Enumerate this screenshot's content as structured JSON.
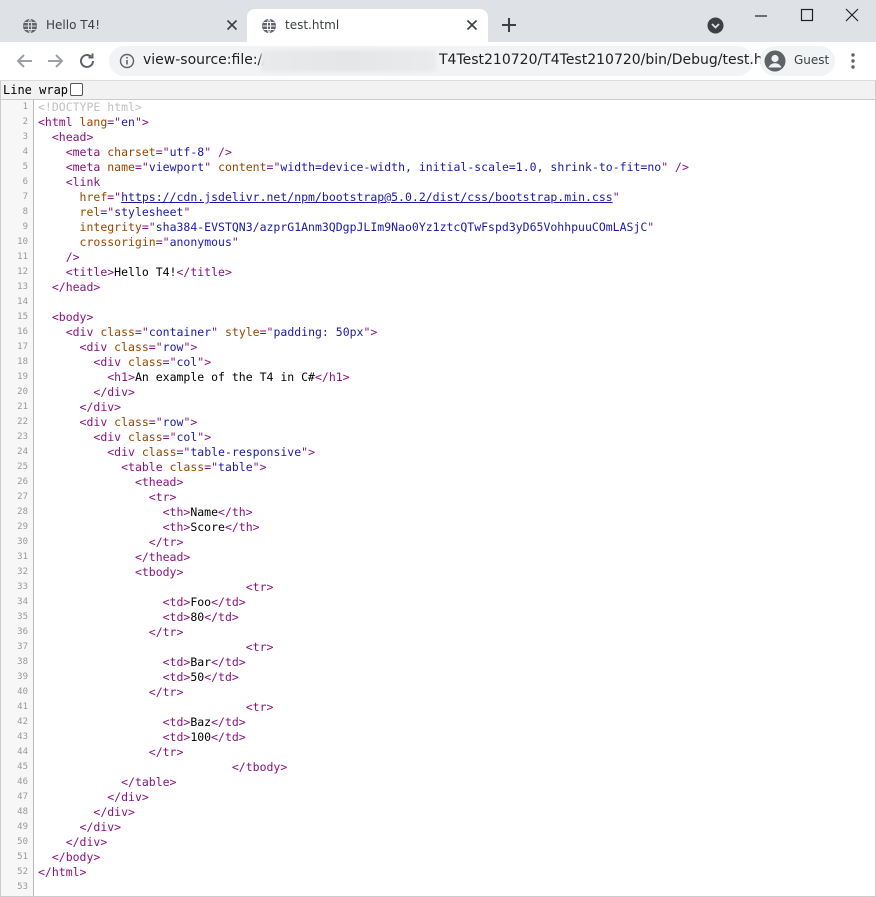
{
  "browser": {
    "tabs": [
      {
        "title": "Hello T4!",
        "active": false,
        "icon": "globe-icon"
      },
      {
        "title": "test.html",
        "active": true,
        "icon": "globe-icon"
      }
    ],
    "address": {
      "prefix": "view-source:file:///",
      "suffix": "T4Test210720/T4Test210720/bin/Debug/test.h..."
    },
    "profile_name": "Guest"
  },
  "colors": {
    "tag": "#881280",
    "attribute": "#994500",
    "value": "#1a1aa6",
    "doctype": "#c0c0c0",
    "tabstrip": "#dee1e6"
  },
  "viewer": {
    "line_wrap_label": "Line wrap",
    "line_wrap_checked": false
  },
  "lines": [
    [
      [
        "doctype",
        "<!DOCTYPE html>"
      ]
    ],
    [
      [
        "tag",
        "<html "
      ],
      [
        "attr",
        "lang"
      ],
      [
        "tag",
        "=\""
      ],
      [
        "val",
        "en"
      ],
      [
        "tag",
        "\">"
      ]
    ],
    [
      [
        "text",
        "  "
      ],
      [
        "tag",
        "<head>"
      ]
    ],
    [
      [
        "text",
        "    "
      ],
      [
        "tag",
        "<meta "
      ],
      [
        "attr",
        "charset"
      ],
      [
        "tag",
        "=\""
      ],
      [
        "val",
        "utf-8"
      ],
      [
        "tag",
        "\" />"
      ]
    ],
    [
      [
        "text",
        "    "
      ],
      [
        "tag",
        "<meta "
      ],
      [
        "attr",
        "name"
      ],
      [
        "tag",
        "=\""
      ],
      [
        "val",
        "viewport"
      ],
      [
        "tag",
        "\" "
      ],
      [
        "attr",
        "content"
      ],
      [
        "tag",
        "=\""
      ],
      [
        "val",
        "width=device-width, initial-scale=1.0, shrink-to-fit=no"
      ],
      [
        "tag",
        "\" />"
      ]
    ],
    [
      [
        "text",
        "    "
      ],
      [
        "tag",
        "<link"
      ]
    ],
    [
      [
        "text",
        "      "
      ],
      [
        "attr",
        "href"
      ],
      [
        "tag",
        "=\""
      ],
      [
        "link",
        "https://cdn.jsdelivr.net/npm/bootstrap@5.0.2/dist/css/bootstrap.min.css"
      ],
      [
        "tag",
        "\""
      ]
    ],
    [
      [
        "text",
        "      "
      ],
      [
        "attr",
        "rel"
      ],
      [
        "tag",
        "=\""
      ],
      [
        "val",
        "stylesheet"
      ],
      [
        "tag",
        "\""
      ]
    ],
    [
      [
        "text",
        "      "
      ],
      [
        "attr",
        "integrity"
      ],
      [
        "tag",
        "=\""
      ],
      [
        "val",
        "sha384-EVSTQN3/azprG1Anm3QDgpJLIm9Nao0Yz1ztcQTwFspd3yD65VohhpuuCOmLASjC"
      ],
      [
        "tag",
        "\""
      ]
    ],
    [
      [
        "text",
        "      "
      ],
      [
        "attr",
        "crossorigin"
      ],
      [
        "tag",
        "=\""
      ],
      [
        "val",
        "anonymous"
      ],
      [
        "tag",
        "\""
      ]
    ],
    [
      [
        "text",
        "    "
      ],
      [
        "tag",
        "/>"
      ]
    ],
    [
      [
        "text",
        "    "
      ],
      [
        "tag",
        "<title>"
      ],
      [
        "text",
        "Hello T4!"
      ],
      [
        "tag",
        "</title>"
      ]
    ],
    [
      [
        "text",
        "  "
      ],
      [
        "tag",
        "</head>"
      ]
    ],
    [],
    [
      [
        "text",
        "  "
      ],
      [
        "tag",
        "<body>"
      ]
    ],
    [
      [
        "text",
        "    "
      ],
      [
        "tag",
        "<div "
      ],
      [
        "attr",
        "class"
      ],
      [
        "tag",
        "=\""
      ],
      [
        "val",
        "container"
      ],
      [
        "tag",
        "\" "
      ],
      [
        "attr",
        "style"
      ],
      [
        "tag",
        "=\""
      ],
      [
        "val",
        "padding: 50px"
      ],
      [
        "tag",
        "\">"
      ]
    ],
    [
      [
        "text",
        "      "
      ],
      [
        "tag",
        "<div "
      ],
      [
        "attr",
        "class"
      ],
      [
        "tag",
        "=\""
      ],
      [
        "val",
        "row"
      ],
      [
        "tag",
        "\">"
      ]
    ],
    [
      [
        "text",
        "        "
      ],
      [
        "tag",
        "<div "
      ],
      [
        "attr",
        "class"
      ],
      [
        "tag",
        "=\""
      ],
      [
        "val",
        "col"
      ],
      [
        "tag",
        "\">"
      ]
    ],
    [
      [
        "text",
        "          "
      ],
      [
        "tag",
        "<h1>"
      ],
      [
        "text",
        "An example of the T4 in C#"
      ],
      [
        "tag",
        "</h1>"
      ]
    ],
    [
      [
        "text",
        "        "
      ],
      [
        "tag",
        "</div>"
      ]
    ],
    [
      [
        "text",
        "      "
      ],
      [
        "tag",
        "</div>"
      ]
    ],
    [
      [
        "text",
        "      "
      ],
      [
        "tag",
        "<div "
      ],
      [
        "attr",
        "class"
      ],
      [
        "tag",
        "=\""
      ],
      [
        "val",
        "row"
      ],
      [
        "tag",
        "\">"
      ]
    ],
    [
      [
        "text",
        "        "
      ],
      [
        "tag",
        "<div "
      ],
      [
        "attr",
        "class"
      ],
      [
        "tag",
        "=\""
      ],
      [
        "val",
        "col"
      ],
      [
        "tag",
        "\">"
      ]
    ],
    [
      [
        "text",
        "          "
      ],
      [
        "tag",
        "<div "
      ],
      [
        "attr",
        "class"
      ],
      [
        "tag",
        "=\""
      ],
      [
        "val",
        "table-responsive"
      ],
      [
        "tag",
        "\">"
      ]
    ],
    [
      [
        "text",
        "            "
      ],
      [
        "tag",
        "<table "
      ],
      [
        "attr",
        "class"
      ],
      [
        "tag",
        "=\""
      ],
      [
        "val",
        "table"
      ],
      [
        "tag",
        "\">"
      ]
    ],
    [
      [
        "text",
        "              "
      ],
      [
        "tag",
        "<thead>"
      ]
    ],
    [
      [
        "text",
        "                "
      ],
      [
        "tag",
        "<tr>"
      ]
    ],
    [
      [
        "text",
        "                  "
      ],
      [
        "tag",
        "<th>"
      ],
      [
        "text",
        "Name"
      ],
      [
        "tag",
        "</th>"
      ]
    ],
    [
      [
        "text",
        "                  "
      ],
      [
        "tag",
        "<th>"
      ],
      [
        "text",
        "Score"
      ],
      [
        "tag",
        "</th>"
      ]
    ],
    [
      [
        "text",
        "                "
      ],
      [
        "tag",
        "</tr>"
      ]
    ],
    [
      [
        "text",
        "              "
      ],
      [
        "tag",
        "</thead>"
      ]
    ],
    [
      [
        "text",
        "              "
      ],
      [
        "tag",
        "<tbody>"
      ]
    ],
    [
      [
        "text",
        "                              "
      ],
      [
        "tag",
        "<tr>"
      ]
    ],
    [
      [
        "text",
        "                  "
      ],
      [
        "tag",
        "<td>"
      ],
      [
        "text",
        "Foo"
      ],
      [
        "tag",
        "</td>"
      ]
    ],
    [
      [
        "text",
        "                  "
      ],
      [
        "tag",
        "<td>"
      ],
      [
        "text",
        "80"
      ],
      [
        "tag",
        "</td>"
      ]
    ],
    [
      [
        "text",
        "                "
      ],
      [
        "tag",
        "</tr>"
      ]
    ],
    [
      [
        "text",
        "                              "
      ],
      [
        "tag",
        "<tr>"
      ]
    ],
    [
      [
        "text",
        "                  "
      ],
      [
        "tag",
        "<td>"
      ],
      [
        "text",
        "Bar"
      ],
      [
        "tag",
        "</td>"
      ]
    ],
    [
      [
        "text",
        "                  "
      ],
      [
        "tag",
        "<td>"
      ],
      [
        "text",
        "50"
      ],
      [
        "tag",
        "</td>"
      ]
    ],
    [
      [
        "text",
        "                "
      ],
      [
        "tag",
        "</tr>"
      ]
    ],
    [
      [
        "text",
        "                              "
      ],
      [
        "tag",
        "<tr>"
      ]
    ],
    [
      [
        "text",
        "                  "
      ],
      [
        "tag",
        "<td>"
      ],
      [
        "text",
        "Baz"
      ],
      [
        "tag",
        "</td>"
      ]
    ],
    [
      [
        "text",
        "                  "
      ],
      [
        "tag",
        "<td>"
      ],
      [
        "text",
        "100"
      ],
      [
        "tag",
        "</td>"
      ]
    ],
    [
      [
        "text",
        "                "
      ],
      [
        "tag",
        "</tr>"
      ]
    ],
    [
      [
        "text",
        "                            "
      ],
      [
        "tag",
        "</tbody>"
      ]
    ],
    [
      [
        "text",
        "            "
      ],
      [
        "tag",
        "</table>"
      ]
    ],
    [
      [
        "text",
        "          "
      ],
      [
        "tag",
        "</div>"
      ]
    ],
    [
      [
        "text",
        "        "
      ],
      [
        "tag",
        "</div>"
      ]
    ],
    [
      [
        "text",
        "      "
      ],
      [
        "tag",
        "</div>"
      ]
    ],
    [
      [
        "text",
        "    "
      ],
      [
        "tag",
        "</div>"
      ]
    ],
    [
      [
        "text",
        "  "
      ],
      [
        "tag",
        "</body>"
      ]
    ],
    [
      [
        "tag",
        "</html>"
      ]
    ],
    []
  ]
}
